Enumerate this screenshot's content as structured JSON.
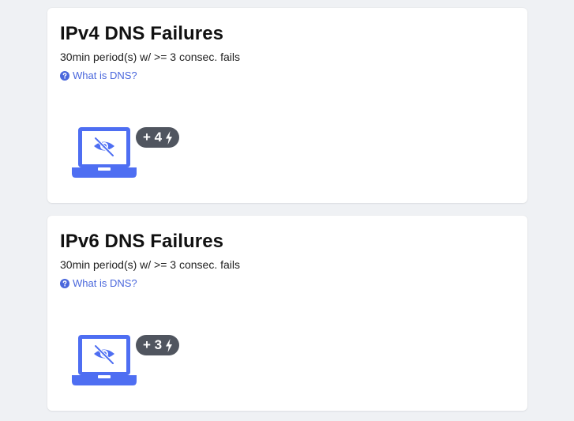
{
  "colors": {
    "accent": "#4a67dc",
    "device": "#4e6ef2",
    "badge_bg": "#50555f",
    "page_bg": "#eff1f4"
  },
  "cards": [
    {
      "title": "IPv4 DNS Failures",
      "subtitle": "30min period(s) w/ >= 3 consec. fails",
      "help_link": "What is DNS?",
      "help_icon": "question-circle-icon",
      "device_icon": "laptop-eye-slash-icon",
      "badge_text": "+ 4",
      "badge_icon": "lightning-bolt-icon"
    },
    {
      "title": "IPv6 DNS Failures",
      "subtitle": "30min period(s) w/ >= 3 consec. fails",
      "help_link": "What is DNS?",
      "help_icon": "question-circle-icon",
      "device_icon": "laptop-eye-slash-icon",
      "badge_text": "+ 3",
      "badge_icon": "lightning-bolt-icon"
    }
  ]
}
